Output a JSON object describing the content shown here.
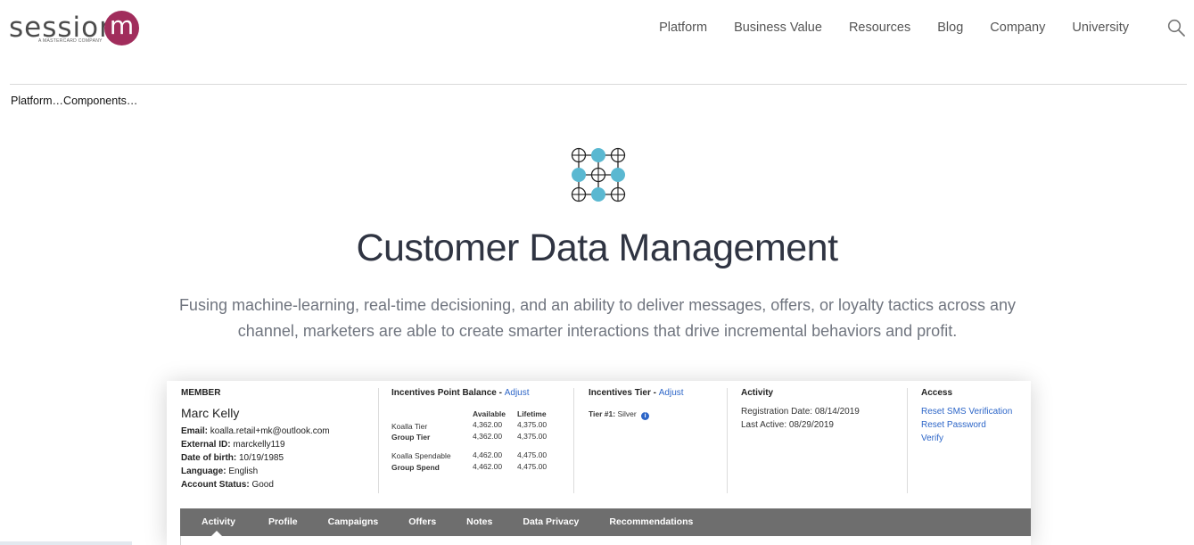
{
  "brand": {
    "word": "session",
    "mark": "m",
    "tagline": "A MASTERCARD COMPANY",
    "color": "#a12d5c"
  },
  "nav": {
    "items": [
      "Platform",
      "Business Value",
      "Resources",
      "Blog",
      "Company",
      "University"
    ],
    "search_icon": "search-icon"
  },
  "breadcrumb": "Platform…Components…",
  "hero": {
    "icon": "node-grid-icon",
    "title": "Customer Data Management",
    "description": "Fusing machine-learning, real-time decisioning, and an ability to deliver messages, offers, or loyalty tactics across any channel, marketers are able to create smarter interactions that drive incremental behaviors and profit."
  },
  "screenshot": {
    "member": {
      "heading": "MEMBER",
      "name": "Marc Kelly",
      "fields": [
        {
          "label": "Email:",
          "value": "koalla.retail+mk@outlook.com"
        },
        {
          "label": "External ID:",
          "value": "marckelly119"
        },
        {
          "label": "Date of birth:",
          "value": "10/19/1985"
        },
        {
          "label": "Language:",
          "value": "English"
        },
        {
          "label": "Account Status:",
          "value": "Good"
        }
      ]
    },
    "points": {
      "heading": "Incentives Point Balance - ",
      "adjust": "Adjust",
      "col_available": "Available",
      "col_lifetime": "Lifetime",
      "rows": [
        {
          "label": "Koalla Tier",
          "available": "4,362.00",
          "lifetime": "4,375.00",
          "bold": false
        },
        {
          "label": "Group Tier",
          "available": "4,362.00",
          "lifetime": "4,375.00",
          "bold": true
        },
        {
          "label": "Koalla Spendable",
          "available": "4,462.00",
          "lifetime": "4,475.00",
          "bold": false
        },
        {
          "label": "Group Spend",
          "available": "4,462.00",
          "lifetime": "4,475.00",
          "bold": true
        }
      ]
    },
    "tier": {
      "heading": "Incentives Tier - ",
      "adjust": "Adjust",
      "label": "Tier #1:",
      "value": "Silver",
      "info": "i"
    },
    "activity": {
      "heading": "Activity",
      "registration": "Registration Date: 08/14/2019",
      "last_active": "Last Active: 08/29/2019"
    },
    "access": {
      "heading": "Access",
      "links": [
        "Reset SMS Verification",
        "Reset Password",
        "Verify"
      ]
    },
    "tabs": [
      "Activity",
      "Profile",
      "Campaigns",
      "Offers",
      "Notes",
      "Data Privacy",
      "Recommendations"
    ],
    "active_tab": "Activity"
  },
  "colors": {
    "accent_teal": "#5ab8d1",
    "link_blue": "#2d66c8",
    "tabbar_gray": "#6e6e6e"
  }
}
